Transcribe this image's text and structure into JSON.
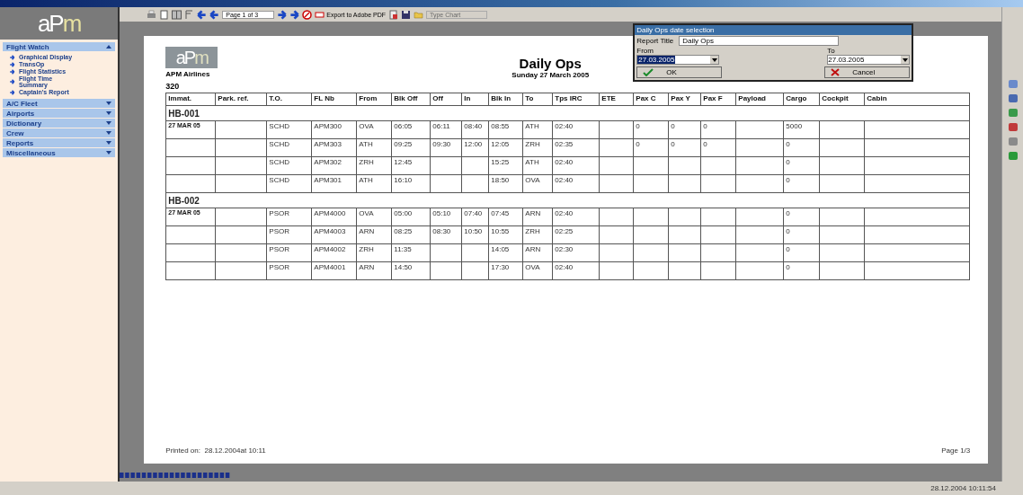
{
  "sidebar": {
    "logo_text": "aPm",
    "sections": [
      {
        "label": "Flight Watch",
        "expanded": true,
        "items": [
          "Graphical Display",
          "TransOp",
          "Flight Statistics",
          "Flight Time Summary",
          "Captain's Report"
        ]
      },
      {
        "label": "A/C Fleet",
        "expanded": false
      },
      {
        "label": "Airports",
        "expanded": false
      },
      {
        "label": "Dictionary",
        "expanded": false
      },
      {
        "label": "Crew",
        "expanded": false
      },
      {
        "label": "Reports",
        "expanded": false
      },
      {
        "label": "Miscellaneous",
        "expanded": false
      }
    ]
  },
  "toolbar": {
    "page_field": "Page 1 of 3",
    "export_button": "Export to Adobe PDF",
    "chart_type": {
      "label": "Type Chart",
      "disabled": true
    }
  },
  "report": {
    "logo_text": "aPm",
    "company": "APM Airlines",
    "title": "Daily Ops",
    "date": "Sunday 27 March 2005",
    "fleet": "320",
    "columns": [
      "Immat.",
      "Park. ref.",
      "T.O.",
      "FL Nb",
      "From",
      "Blk Off",
      "Off",
      "In",
      "Blk In",
      "To",
      "Tps IRC",
      "ETE",
      "Pax C",
      "Pax Y",
      "Pax F",
      "Payload",
      "Cargo",
      "Cockpit",
      "Cabin"
    ],
    "groups": [
      {
        "name": "HB-001",
        "rows": [
          [
            "27 MAR 05",
            null,
            "SCHD",
            "APM300",
            "OVA",
            "06:05",
            "06:11",
            "08:40",
            "08:55",
            "ATH",
            "02:40",
            null,
            "0",
            "0",
            "0",
            null,
            "5000",
            null,
            null
          ],
          [
            null,
            null,
            "SCHD",
            "APM303",
            "ATH",
            "09:25",
            "09:30",
            "12:00",
            "12:05",
            "ZRH",
            "02:35",
            null,
            "0",
            "0",
            "0",
            null,
            "0",
            null,
            null
          ],
          [
            null,
            null,
            "SCHD",
            "APM302",
            "ZRH",
            "12:45",
            null,
            null,
            "15:25",
            "ATH",
            "02:40",
            null,
            null,
            null,
            null,
            null,
            "0",
            null,
            null
          ],
          [
            null,
            null,
            "SCHD",
            "APM301",
            "ATH",
            "16:10",
            null,
            null,
            "18:50",
            "OVA",
            "02:40",
            null,
            null,
            null,
            null,
            null,
            "0",
            null,
            null
          ]
        ]
      },
      {
        "name": "HB-002",
        "rows": [
          [
            "27 MAR 05",
            null,
            "PSOR",
            "APM4000",
            "OVA",
            "05:00",
            "05:10",
            "07:40",
            "07:45",
            "ARN",
            "02:40",
            null,
            null,
            null,
            null,
            null,
            "0",
            null,
            null
          ],
          [
            null,
            null,
            "PSOR",
            "APM4003",
            "ARN",
            "08:25",
            "08:30",
            "10:50",
            "10:55",
            "ZRH",
            "02:25",
            null,
            null,
            null,
            null,
            null,
            "0",
            null,
            null
          ],
          [
            null,
            null,
            "PSOR",
            "APM4002",
            "ZRH",
            "11:35",
            null,
            null,
            "14:05",
            "ARN",
            "02:30",
            null,
            null,
            null,
            null,
            null,
            "0",
            null,
            null
          ],
          [
            null,
            null,
            "PSOR",
            "APM4001",
            "ARN",
            "14:50",
            null,
            null,
            "17:30",
            "OVA",
            "02:40",
            null,
            null,
            null,
            null,
            null,
            "0",
            null,
            null
          ]
        ]
      }
    ],
    "printed_label": "Printed on:",
    "printed_value": "28.12.2004at 10:11",
    "page": "Page 1/3"
  },
  "dialog": {
    "title": "Daily Ops date selection",
    "report_title_label": "Report Title",
    "report_title": "Daily Ops",
    "from_label": "From",
    "from_value": "27.03.2005",
    "to_label": "To",
    "to_value": "27.03.2005",
    "ok": "OK",
    "cancel": "Cancel"
  },
  "status_bar": {
    "clock": "28.12.2004 10:11:54"
  }
}
